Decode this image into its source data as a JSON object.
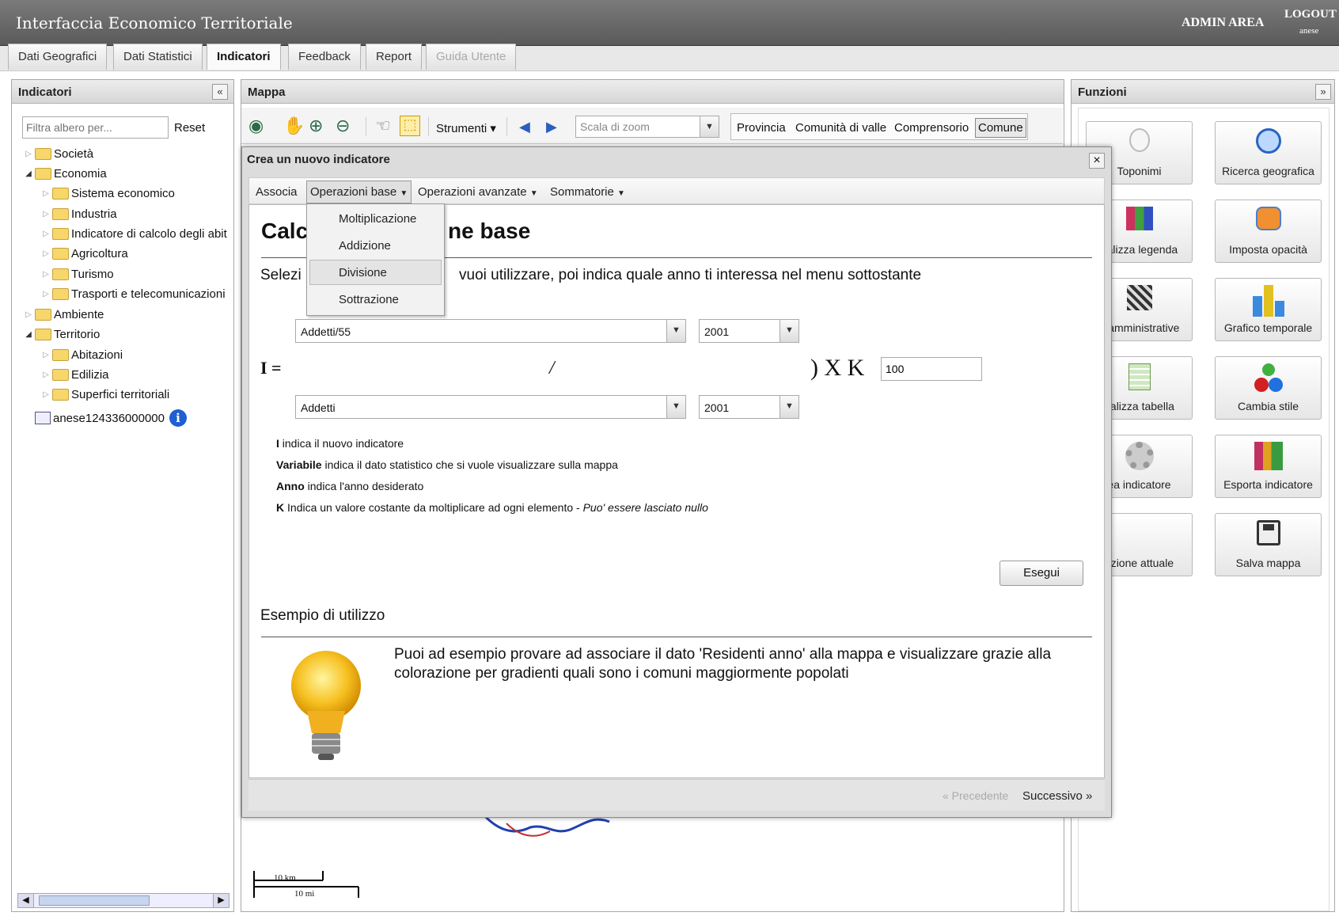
{
  "header": {
    "title": "Interfaccia Economico Territoriale",
    "admin_area": "ADMIN AREA",
    "logout": "LOGOUT",
    "user": "anese"
  },
  "tabs": [
    "Dati Geografici",
    "Dati Statistici",
    "Indicatori",
    "Feedback",
    "Report",
    "Guida Utente"
  ],
  "active_tab": "Indicatori",
  "left_panel": {
    "title": "Indicatori",
    "collapse": "«",
    "filter_placeholder": "Filtra albero per...",
    "reset": "Reset",
    "tree": [
      "Società",
      "Economia",
      "Sistema economico",
      "Industria",
      "Indicatore di calcolo degli abit",
      "Agricoltura",
      "Turismo",
      "Trasporti e telecomunicazioni",
      "Ambiente",
      "Territorio",
      "Abitazioni",
      "Edilizia",
      "Superfici territoriali",
      "anese124336000000"
    ]
  },
  "map": {
    "title": "Mappa",
    "strumenti": "Strumenti",
    "scale_placeholder": "Scala di zoom",
    "levels": [
      "Provincia",
      "Comunità di valle",
      "Comprensorio",
      "Comune"
    ],
    "scalebar_km": "10 km",
    "scalebar_mi": "10 mi"
  },
  "functions": {
    "title": "Funzioni",
    "collapse": "»",
    "buttons": [
      "Toponimi",
      "Ricerca geografica",
      "ualizza legenda",
      "Imposta opacità",
      "e amministrative",
      "Grafico temporale",
      "ualizza tabella",
      "Cambia stile",
      "ea indicatore",
      "Esporta indicatore",
      "ezione attuale",
      "Salva mappa"
    ]
  },
  "dialog": {
    "title": "Crea un nuovo indicatore",
    "close": "×",
    "menu": [
      "Associa",
      "Operazioni base",
      "Operazioni avanzate",
      "Sommatorie"
    ],
    "dropdown": [
      "Moltiplicazione",
      "Addizione",
      "Divisione",
      "Sottrazione"
    ],
    "heading_left": "Calc",
    "heading_right": "ne base",
    "instruction_left": "Selezi",
    "instruction_right": "vuoi utilizzare, poi indica quale anno ti interessa nel menu sottostante",
    "numerator_var": "Addetti/55",
    "numerator_year": "2001",
    "denominator_var": "Addetti",
    "denominator_year": "2001",
    "formula_i": "I =",
    "formula_slash": "/",
    "formula_xk": ") X K",
    "k_value": "100",
    "legend": {
      "l1_b": "I",
      "l1": " indica il nuovo indicatore",
      "l2_b": "Variabile",
      "l2": " indica il dato statistico che si vuole visualizzare sulla mappa",
      "l3_b": "Anno",
      "l3": " indica l'anno desiderato",
      "l4_b": "K",
      "l4": " Indica un valore costante da moltiplicare ad ogni elemento - ",
      "l4_i": "Puo' essere lasciato nullo"
    },
    "execute": "Esegui",
    "example_title": "Esempio di utilizzo",
    "example_text": "Puoi ad esempio provare ad associare il dato 'Residenti anno' alla mappa e visualizzare grazie alla colorazione per gradienti quali sono i comuni maggiormente popolati",
    "prev": "« Precedente",
    "next": "Successivo »"
  }
}
